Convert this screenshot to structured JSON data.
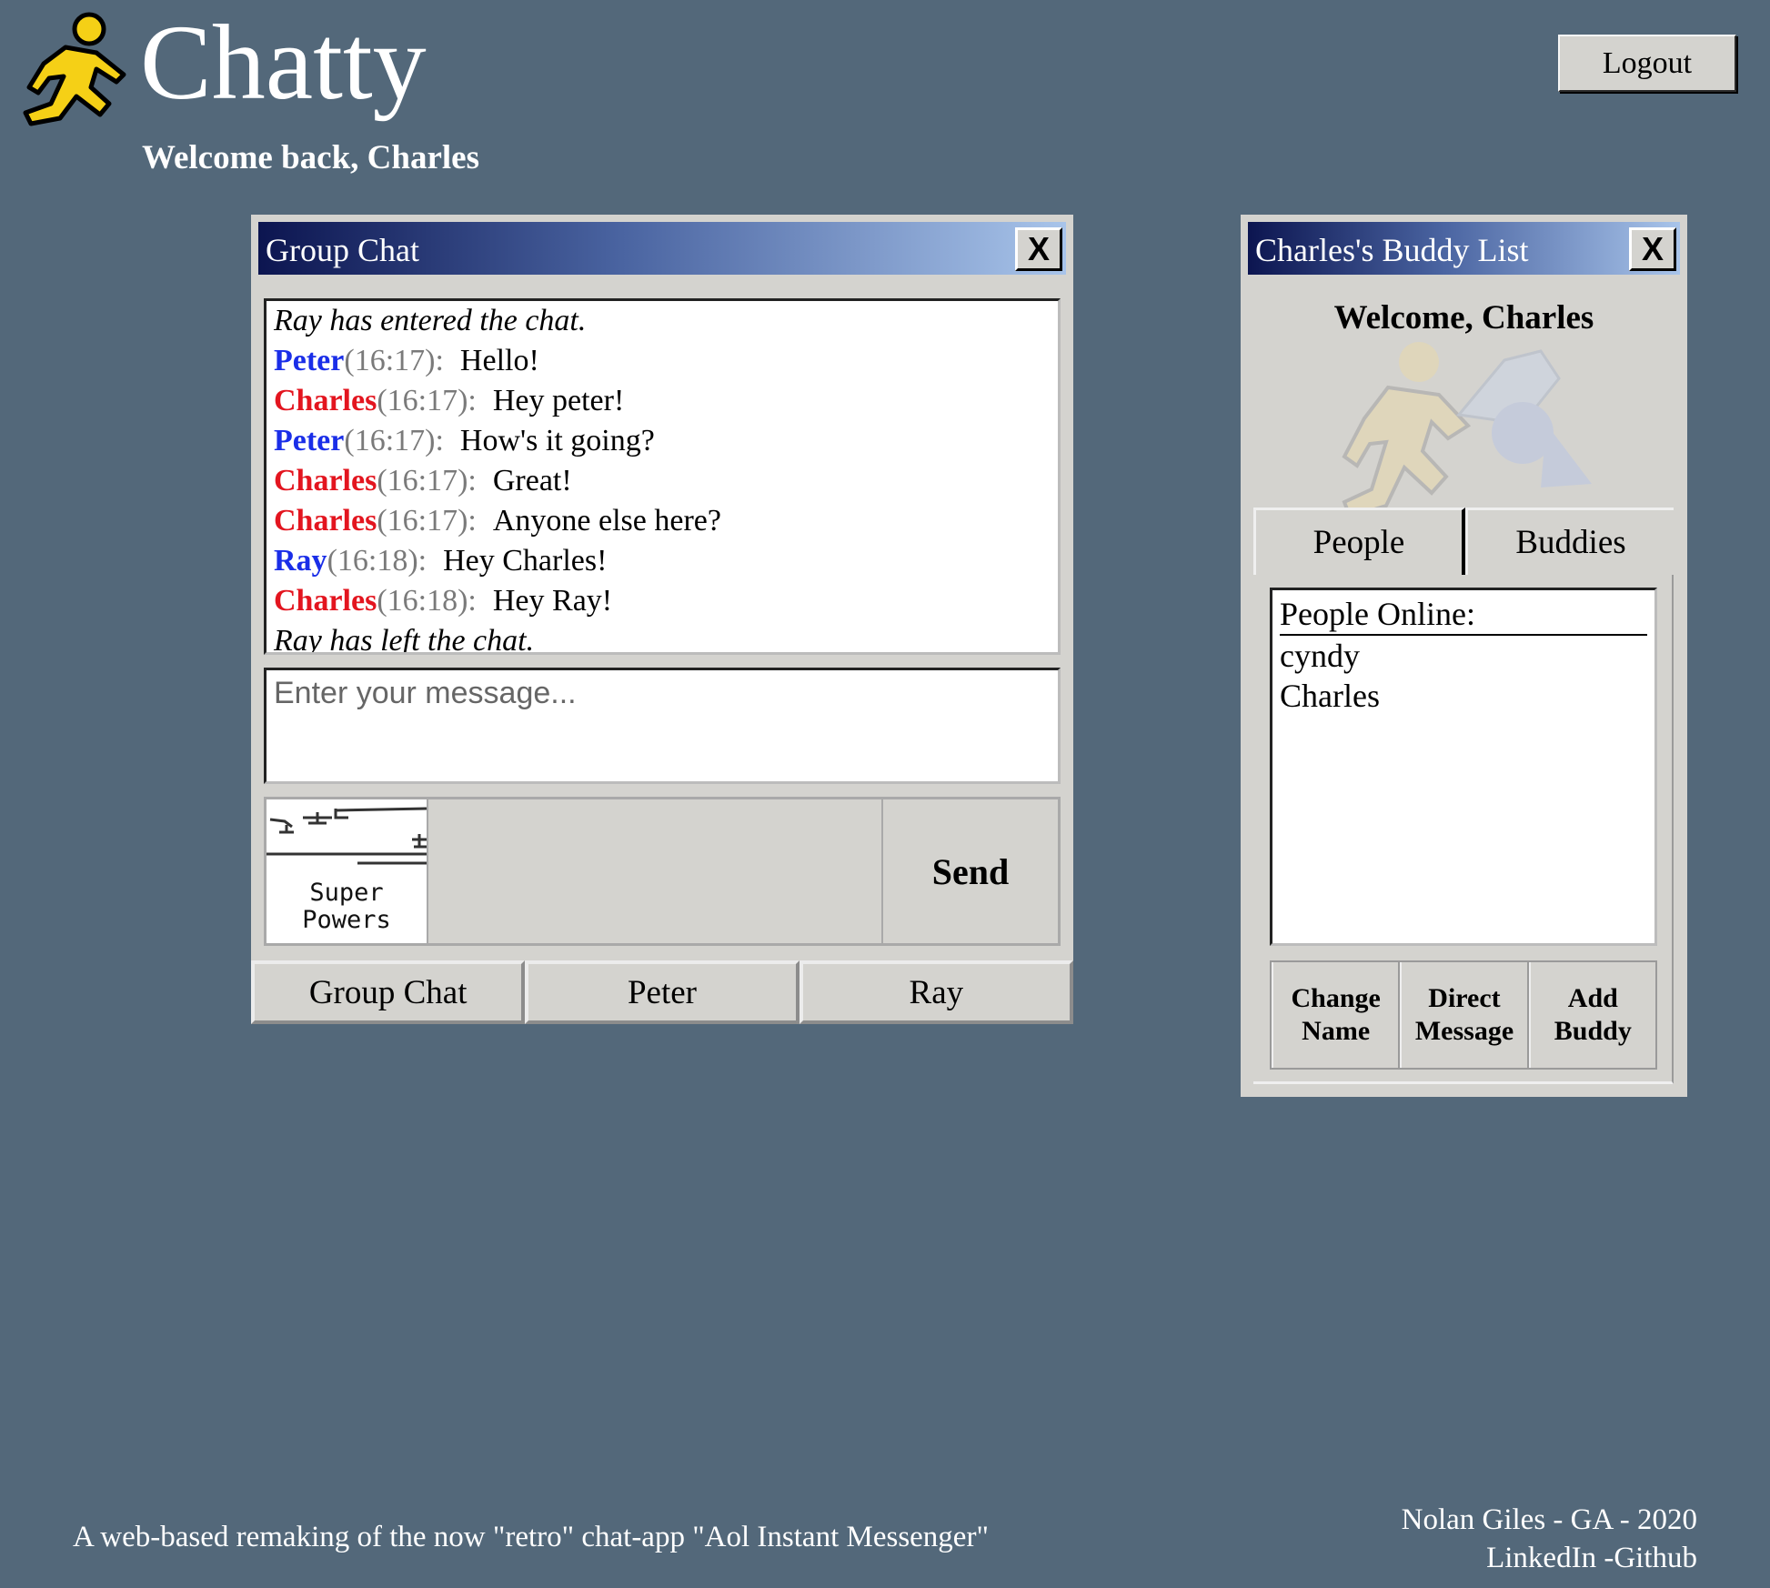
{
  "header": {
    "app_title": "Chatty",
    "welcome_back": "Welcome back, Charles",
    "logout_label": "Logout",
    "logo_icon": "running-man-icon",
    "logo_color": "#f5d016"
  },
  "group_chat": {
    "title": "Group Chat",
    "close_label": "X",
    "messages": [
      {
        "type": "system",
        "text": "Ray has entered the chat."
      },
      {
        "type": "message",
        "sender": "Peter",
        "time": "(16:17):",
        "text": "Hello!",
        "color": "#1a2ee8"
      },
      {
        "type": "message",
        "sender": "Charles",
        "time": "(16:17):",
        "text": "Hey peter!",
        "color": "#e3151f"
      },
      {
        "type": "message",
        "sender": "Peter",
        "time": "(16:17):",
        "text": "How's it going?",
        "color": "#1a2ee8"
      },
      {
        "type": "message",
        "sender": "Charles",
        "time": "(16:17):",
        "text": "Great!",
        "color": "#e3151f"
      },
      {
        "type": "message",
        "sender": "Charles",
        "time": "(16:17):",
        "text": "Anyone else here?",
        "color": "#e3151f"
      },
      {
        "type": "message",
        "sender": "Ray",
        "time": "(16:18):",
        "text": "Hey Charles!",
        "color": "#1a2ee8"
      },
      {
        "type": "message",
        "sender": "Charles",
        "time": "(16:18):",
        "text": "Hey Ray!",
        "color": "#e3151f"
      },
      {
        "type": "system",
        "text": "Ray has left the chat."
      }
    ],
    "input_placeholder": "Enter your message...",
    "input_value": "",
    "powers_caption_1": "Super",
    "powers_caption_2": "Powers",
    "send_label": "Send",
    "tabs": [
      "Group Chat",
      "Peter",
      "Ray"
    ]
  },
  "buddy_list": {
    "title": "Charles's Buddy List",
    "close_label": "X",
    "welcome": "Welcome, Charles",
    "tabs": [
      "People",
      "Buddies"
    ],
    "active_tab": "People",
    "people_header": "People Online:",
    "people": [
      "cyndy",
      "Charles"
    ],
    "actions": [
      {
        "line1": "Change",
        "line2": "Name"
      },
      {
        "line1": "Direct",
        "line2": "Message"
      },
      {
        "line1": "Add",
        "line2": "Buddy"
      }
    ]
  },
  "footer": {
    "description": "A web-based remaking of the now \"retro\" chat-app \"Aol Instant Messenger\"",
    "credit": "Nolan Giles - GA - 2020",
    "link_linkedin": "LinkedIn",
    "link_github": "-Github"
  }
}
